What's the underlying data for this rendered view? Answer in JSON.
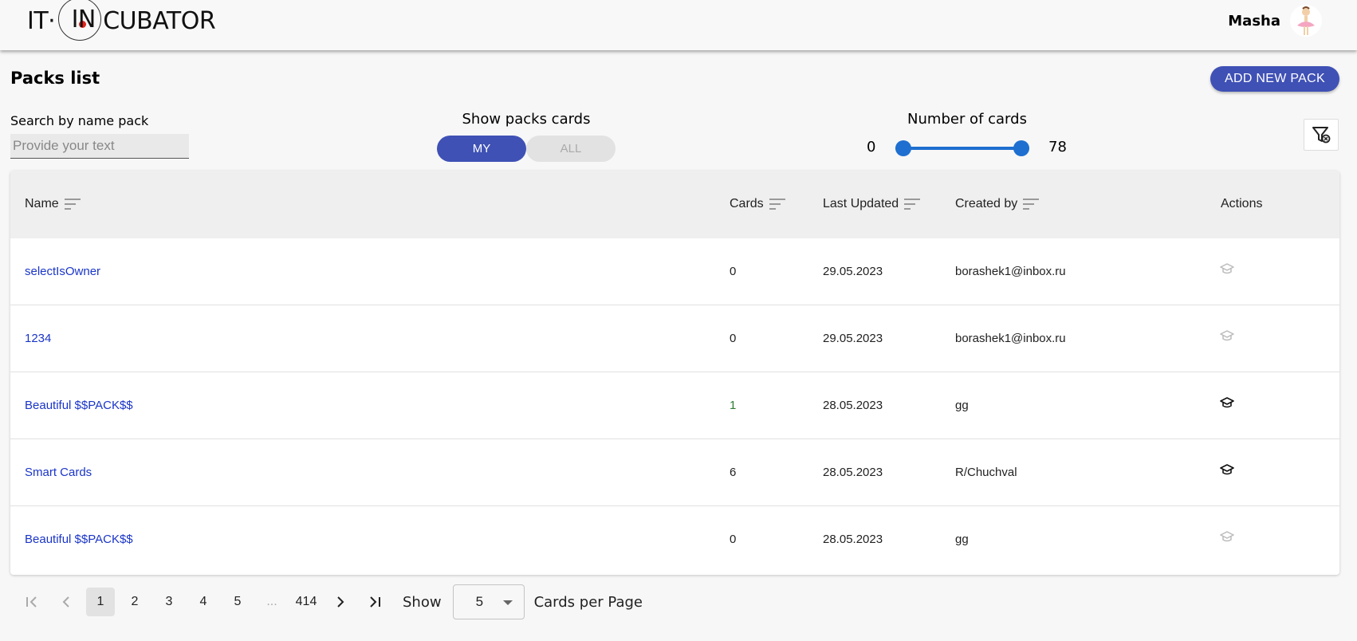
{
  "header": {
    "logo_it": "IT·",
    "logo_in": "IN",
    "logo_rest": "CUBATOR",
    "user_name": "Masha"
  },
  "page": {
    "title": "Packs list",
    "add_button": "ADD NEW PACK"
  },
  "search": {
    "label": "Search by name pack",
    "placeholder": "Provide your text",
    "value": ""
  },
  "toggle": {
    "label": "Show packs cards",
    "my": "MY",
    "all": "ALL",
    "selected": "MY"
  },
  "range": {
    "label": "Number of cards",
    "min": "0",
    "max": "78",
    "value_min": 0,
    "value_max": 78
  },
  "table": {
    "columns": {
      "name": "Name",
      "cards": "Cards",
      "updated": "Last Updated",
      "created": "Created by",
      "actions": "Actions"
    },
    "rows": [
      {
        "name": "selectIsOwner",
        "cards": "0",
        "updated": "29.05.2023",
        "created": "borashek1@inbox.ru",
        "learn_enabled": false
      },
      {
        "name": "1234",
        "cards": "0",
        "updated": "29.05.2023",
        "created": "borashek1@inbox.ru",
        "learn_enabled": false
      },
      {
        "name": "Beautiful $$PACK$$",
        "cards": "1",
        "updated": "28.05.2023",
        "created": "gg",
        "learn_enabled": true
      },
      {
        "name": "Smart Cards",
        "cards": "6",
        "updated": "28.05.2023",
        "created": "R/Chuchval",
        "learn_enabled": true
      },
      {
        "name": "Beautiful $$PACK$$",
        "cards": "0",
        "updated": "28.05.2023",
        "created": "gg",
        "learn_enabled": false
      }
    ]
  },
  "pagination": {
    "pages": [
      "1",
      "2",
      "3",
      "4",
      "5",
      "...",
      "414"
    ],
    "current": "1",
    "show_label": "Show",
    "per_page_value": "5",
    "per_page_label": "Cards per Page"
  },
  "colors": {
    "primary": "#3f51b5",
    "slider": "#1e6fd0",
    "link": "#1a35c8"
  }
}
